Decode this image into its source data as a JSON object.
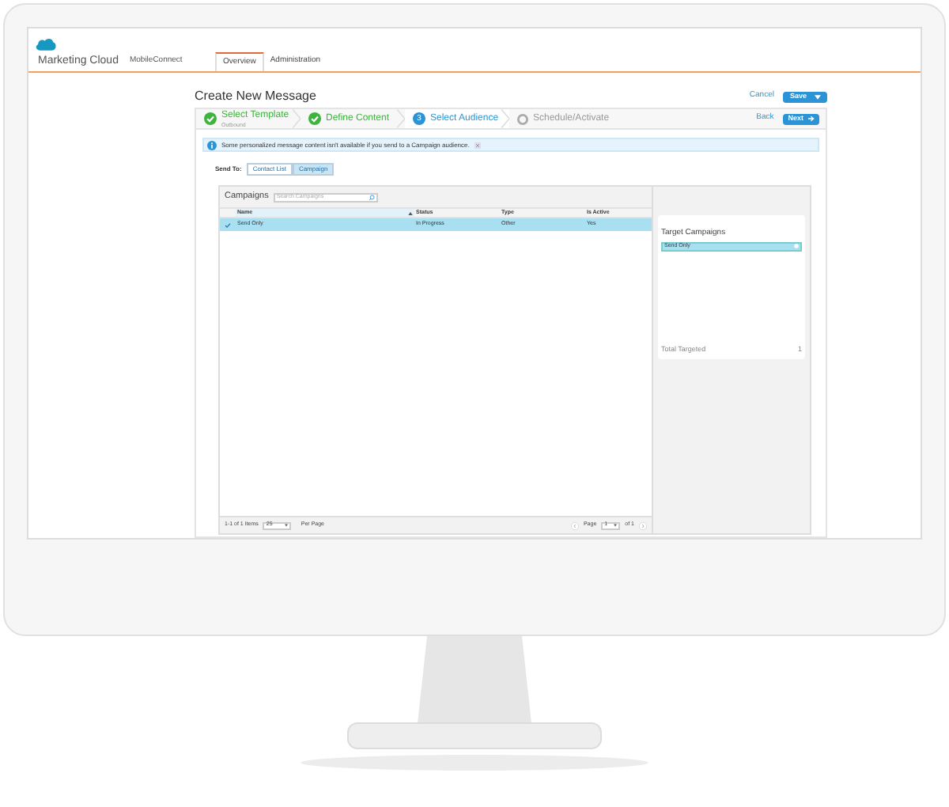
{
  "nav": {
    "app_name": "Marketing Cloud",
    "product": "MobileConnect"
  },
  "tabs": [
    {
      "label": "Overview",
      "selected": true
    },
    {
      "label": "Administration",
      "selected": false
    }
  ],
  "page_title": "Create New Message",
  "header_actions": {
    "cancel": "Cancel",
    "save": "Save"
  },
  "steps": [
    {
      "label": "Select Template",
      "sublabel": "Outbound",
      "completed": true,
      "selected": false
    },
    {
      "label": "Define Content",
      "completed": true,
      "selected": false
    },
    {
      "label": "Select Audience",
      "number": "3",
      "completed": false,
      "selected": true
    },
    {
      "label": "Schedule/Activate",
      "completed": false,
      "selected": false
    }
  ],
  "step_actions": {
    "back": "Back",
    "next": "Next"
  },
  "info_message": "Some personalized message content isn't available if you send to a Campaign audience.",
  "send_to": {
    "label": "Send To:",
    "options": [
      {
        "label": "Contact List",
        "selected": false
      },
      {
        "label": "Campaign",
        "selected": true
      }
    ]
  },
  "campaigns": {
    "title": "Campaigns",
    "search_placeholder": "Search Campaigns",
    "columns": [
      "Name",
      "Status",
      "Type",
      "Is Active"
    ],
    "rows": [
      {
        "cells": [
          "Send Only",
          "In Progress",
          "Other",
          "Yes"
        ],
        "selected": true
      }
    ],
    "footer": {
      "range": "1-1 of 1 Items",
      "per_page_value": "25",
      "per_page_label": "Per Page",
      "page_label": "Page",
      "page_value": "1",
      "page_total": "of 1"
    }
  },
  "target": {
    "title": "Target Campaigns",
    "items": [
      "Send Only"
    ],
    "total_label": "Total Targeted",
    "total": "1"
  }
}
